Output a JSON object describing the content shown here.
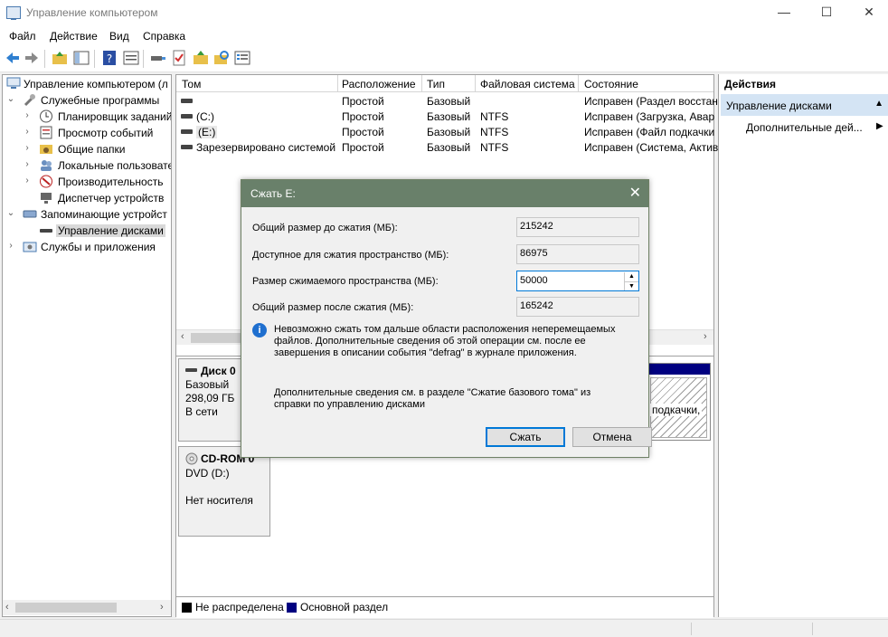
{
  "window": {
    "title": "Управление компьютером"
  },
  "menu": [
    "Файл",
    "Действие",
    "Вид",
    "Справка"
  ],
  "tree": {
    "root": "Управление компьютером (л",
    "system_tools": "Служебные программы",
    "task_scheduler": "Планировщик заданий",
    "event_viewer": "Просмотр событий",
    "shared_folders": "Общие папки",
    "local_users": "Локальные пользовате",
    "performance": "Производительность",
    "device_manager": "Диспетчер устройств",
    "storage": "Запоминающие устройст",
    "disk_management": "Управление дисками",
    "services": "Службы и приложения"
  },
  "volume_table": {
    "columns": [
      "Том",
      "Расположение",
      "Тип",
      "Файловая система",
      "Состояние"
    ],
    "rows": [
      {
        "volume": "",
        "layout": "Простой",
        "type": "Базовый",
        "fs": "",
        "status": "Исправен (Раздел восстан"
      },
      {
        "volume": "(C:)",
        "layout": "Простой",
        "type": "Базовый",
        "fs": "NTFS",
        "status": "Исправен (Загрузка, Авар"
      },
      {
        "volume": "(E:)",
        "layout": "Простой",
        "type": "Базовый",
        "fs": "NTFS",
        "status": "Исправен (Файл подкачки"
      },
      {
        "volume": "Зарезервировано системой",
        "layout": "Простой",
        "type": "Базовый",
        "fs": "NTFS",
        "status": "Исправен (Система, Актив"
      }
    ]
  },
  "disks": {
    "disk0": {
      "name": "Диск 0",
      "type": "Базовый",
      "size": "298,09 ГБ",
      "state": "В сети",
      "partial_text": "подкачки,"
    },
    "cdrom0": {
      "name": "CD-ROM 0",
      "drive": "DVD (D:)",
      "state": "Нет носителя"
    }
  },
  "legend": {
    "unallocated": "Не распределена",
    "primary": "Основной раздел"
  },
  "actions": {
    "title": "Действия",
    "section": "Управление дисками",
    "item": "Дополнительные дей..."
  },
  "dialog": {
    "title": "Сжать E:",
    "total_before_label": "Общий размер до сжатия (МБ):",
    "total_before_value": "215242",
    "available_label": "Доступное для сжатия пространство (МБ):",
    "available_value": "86975",
    "shrink_label": "Размер сжимаемого пространства (МБ):",
    "shrink_value": "50000",
    "total_after_label": "Общий размер после сжатия (МБ):",
    "total_after_value": "165242",
    "info_line1": "Невозможно сжать том дальше области расположения неперемещаемых",
    "info_line2": "файлов. Дополнительные сведения об этой операции см. после ее",
    "info_line3": "завершения в описании события \"defrag\" в журнале приложения.",
    "more_line1": "Дополнительные сведения см. в разделе \"Сжатие базового тома\" из",
    "more_line2": "справки по управлению дисками",
    "shrink_button": "Сжать",
    "cancel_button": "Отмена"
  },
  "colors": {
    "dialog_title": "#69806a",
    "primary_partition": "#000080",
    "selection": "#d4e4f4"
  }
}
